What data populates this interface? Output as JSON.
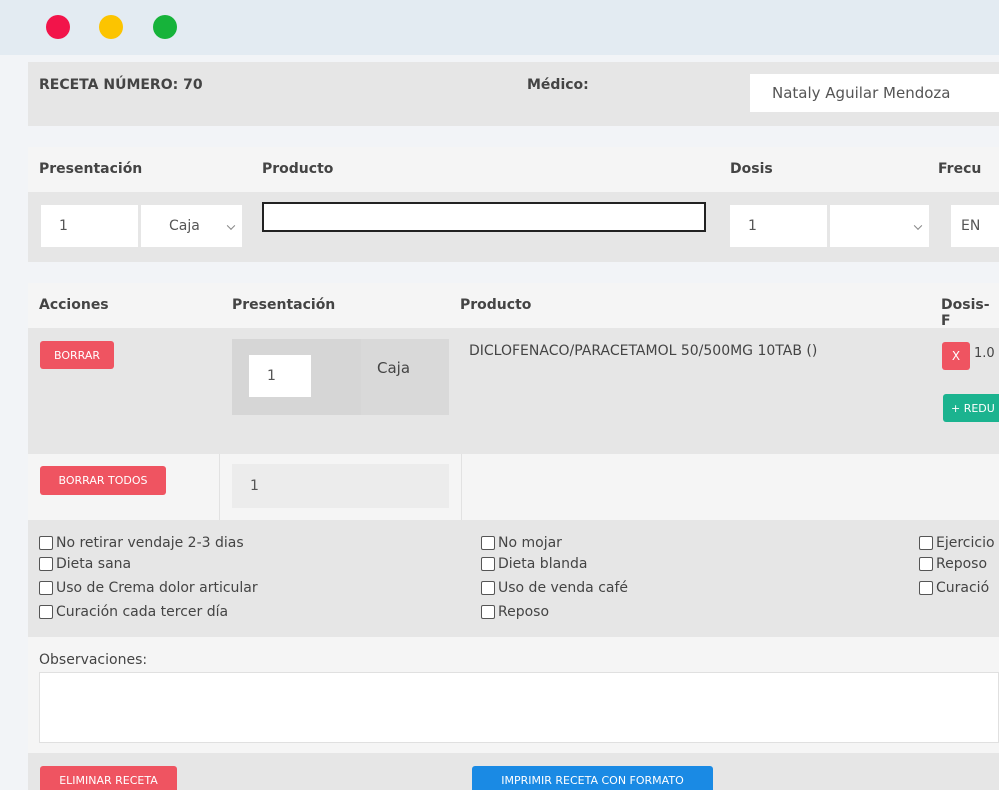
{
  "header": {
    "receta_label": "RECETA NÚMERO: 70",
    "medico_label": "Médico:",
    "medico_value": "Nataly Aguilar Mendoza"
  },
  "entry": {
    "headers": [
      "Presentación",
      "Producto",
      "Dosis",
      "Frecu"
    ],
    "presentacion_qty": "1",
    "presentacion_unit": "Caja",
    "producto_value": "",
    "dosis_qty": "1",
    "dosis_unit": "",
    "frecuencia_value": "EN"
  },
  "table": {
    "headers": [
      "Acciones",
      "Presentación",
      "Producto",
      "Dosis-F"
    ],
    "row": {
      "delete_label": "BORRAR",
      "qty": "1",
      "unit": "Caja",
      "product": "DICLOFENACO/PARACETAMOL 50/500MG 10TAB ()",
      "remove_label": "X",
      "dosis_value": "1.0",
      "reduce_label": "+ REDU"
    },
    "delete_all_label": "BORRAR TODOS",
    "total_qty": "1"
  },
  "recommendations": {
    "col1": [
      "No retirar vendaje 2-3 dias",
      "Dieta sana",
      "Uso de Crema dolor articular",
      "Curación cada tercer día"
    ],
    "col2": [
      "No mojar",
      "Dieta blanda",
      "Uso de venda café",
      "Reposo"
    ],
    "col3": [
      "Ejercicio",
      "Reposo",
      "Curació"
    ]
  },
  "observations": {
    "label": "Observaciones:",
    "value": ""
  },
  "footer": {
    "delete_recipe_label": "ELIMINAR RECETA",
    "print_label": "IMPRIMIR RECETA CON FORMATO"
  },
  "colors": {
    "danger": "#ef5461",
    "success": "#1bb38f",
    "primary": "#1a8ae4"
  }
}
